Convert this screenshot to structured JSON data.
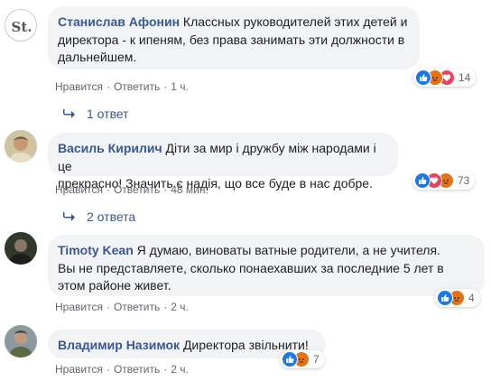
{
  "comments": [
    {
      "author": "Станислав Афонин",
      "text_lines": [
        "Классных руководителей этих детей и",
        "директора - к ипеням, без права занимать эти должности в",
        "дальнейшем."
      ],
      "avatar_text": "St.",
      "actions": {
        "like": "Нравится",
        "reply": "Ответить",
        "time": "1 ч."
      },
      "reactions_count": "14",
      "replies_label": "1 ответ"
    },
    {
      "author": "Василь Кирилич",
      "text_lines": [
        "Діти за мир і дружбу між народами і це",
        "прекрасно! Значить є надія, що все буде в нас добре."
      ],
      "actions": {
        "like": "Нравится",
        "reply": "Ответить",
        "time": "48 мин."
      },
      "reactions_count": "73",
      "replies_label": "2 ответа"
    },
    {
      "author": "Timoty Kean",
      "text_lines": [
        "Я думаю, виноваты ватные родители, а не учителя.",
        "Вы не представляете, сколько понаехавших за последние 5 лет в",
        "этом районе живет."
      ],
      "actions": {
        "like": "Нравится",
        "reply": "Ответить",
        "time": "2 ч."
      },
      "reactions_count": "4"
    },
    {
      "author": "Владимир Назимок",
      "text_lines": [
        "Директора звільнити!"
      ],
      "actions": {
        "like": "Нравится",
        "reply": "Ответить",
        "time": "2 ч."
      },
      "reactions_count": "7"
    }
  ],
  "colors": {
    "author": "#385898",
    "bubble": "#f2f3f5",
    "like": "#1877f2",
    "angry": "#e9710f",
    "love": "#f33e58"
  }
}
